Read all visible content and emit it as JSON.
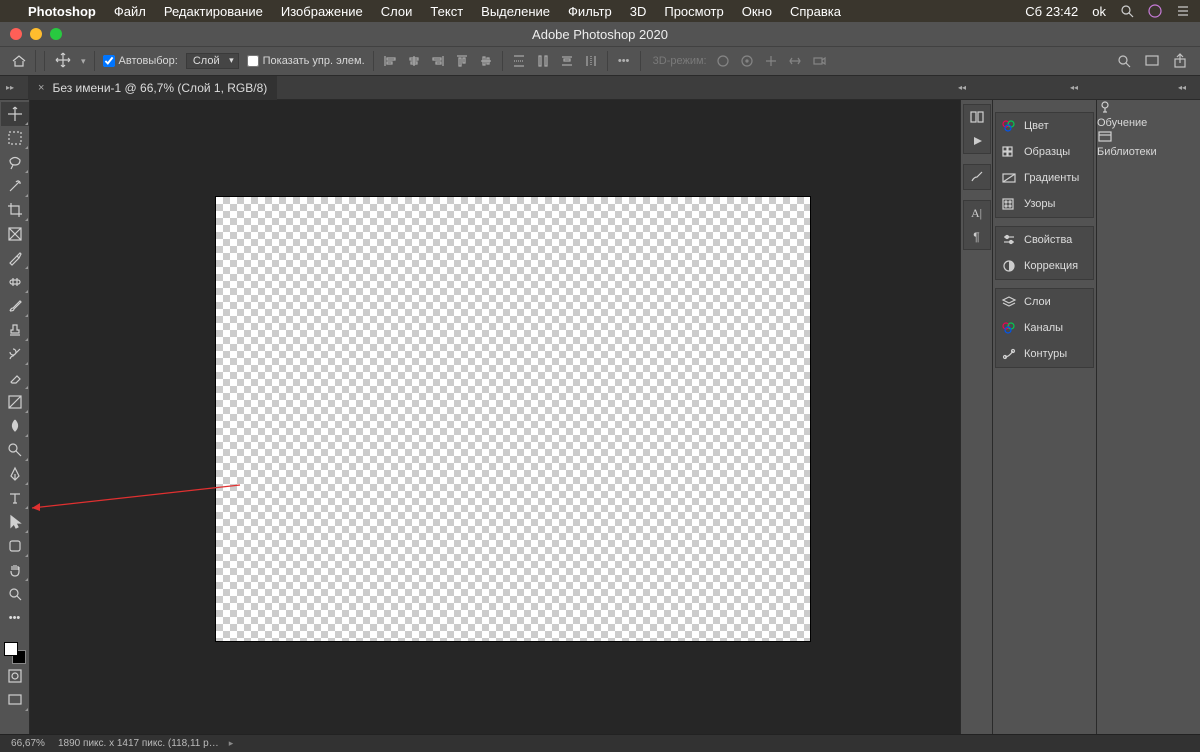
{
  "menubar": {
    "app": "Photoshop",
    "items": [
      "Файл",
      "Редактирование",
      "Изображение",
      "Слои",
      "Текст",
      "Выделение",
      "Фильтр",
      "3D",
      "Просмотр",
      "Окно",
      "Справка"
    ],
    "clock": "Сб 23:42",
    "user": "ok"
  },
  "window": {
    "title": "Adobe Photoshop 2020"
  },
  "optbar": {
    "autoselect_label": "Автовыбор:",
    "autoselect_value": "Слой",
    "show_controls": "Показать упр. элем.",
    "threed_label": "3D-режим:"
  },
  "doc": {
    "tab_label": "Без имени-1 @ 66,7% (Слой 1, RGB/8)"
  },
  "panels_mid": {
    "g1": [
      "Цвет",
      "Образцы",
      "Градиенты",
      "Узоры"
    ],
    "g2": [
      "Свойства",
      "Коррекция"
    ],
    "g3": [
      "Слои",
      "Каналы",
      "Контуры"
    ]
  },
  "panels_right": {
    "g1": [
      "Обучение"
    ],
    "g2": [
      "Библиотеки"
    ]
  },
  "status": {
    "zoom": "66,67%",
    "dims": "1890 пикс. x 1417 пикс. (118,11 p…"
  }
}
